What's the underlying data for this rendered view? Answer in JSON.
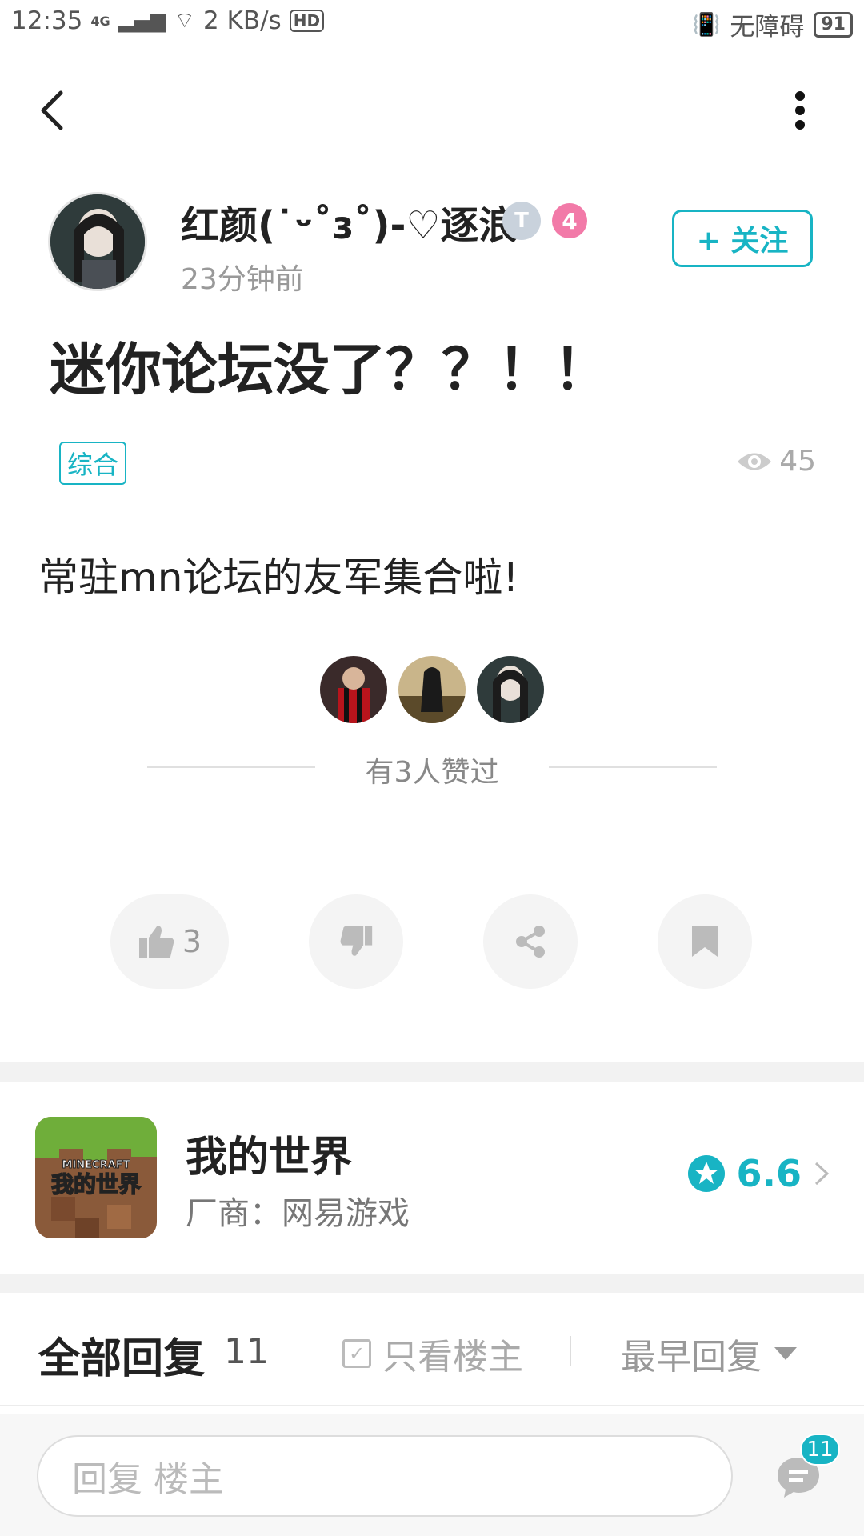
{
  "status_bar": {
    "time": "12:35",
    "network": "4G",
    "speed": "2 KB/s",
    "hd": "HD",
    "accessibility": "无障碍",
    "battery": "91"
  },
  "author": {
    "name": "红颜(˙ᵕ˚ɜ˚)-♡逐浪",
    "badge_t": "T",
    "level": "4",
    "time": "23分钟前",
    "follow_label": "+ 关注"
  },
  "post": {
    "title": "迷你论坛没了？？！！",
    "tag": "综合",
    "views": "45",
    "content": "常驻mn论坛的友军集合啦!",
    "likes_text": "有3人赞过"
  },
  "actions": {
    "like_count": "3"
  },
  "game": {
    "name": "我的世界",
    "vendor": "厂商：网易游戏",
    "rating": "6.6",
    "icon_text_top": "MINECRAFT",
    "icon_text_bottom": "我的世界"
  },
  "replies": {
    "title": "全部回复",
    "count": "11",
    "only_host": "只看楼主",
    "sort": "最早回复"
  },
  "bottom": {
    "placeholder": "回复  楼主",
    "comment_badge": "11"
  },
  "colors": {
    "accent": "#18b4c4",
    "level_badge": "#f27aa8"
  }
}
